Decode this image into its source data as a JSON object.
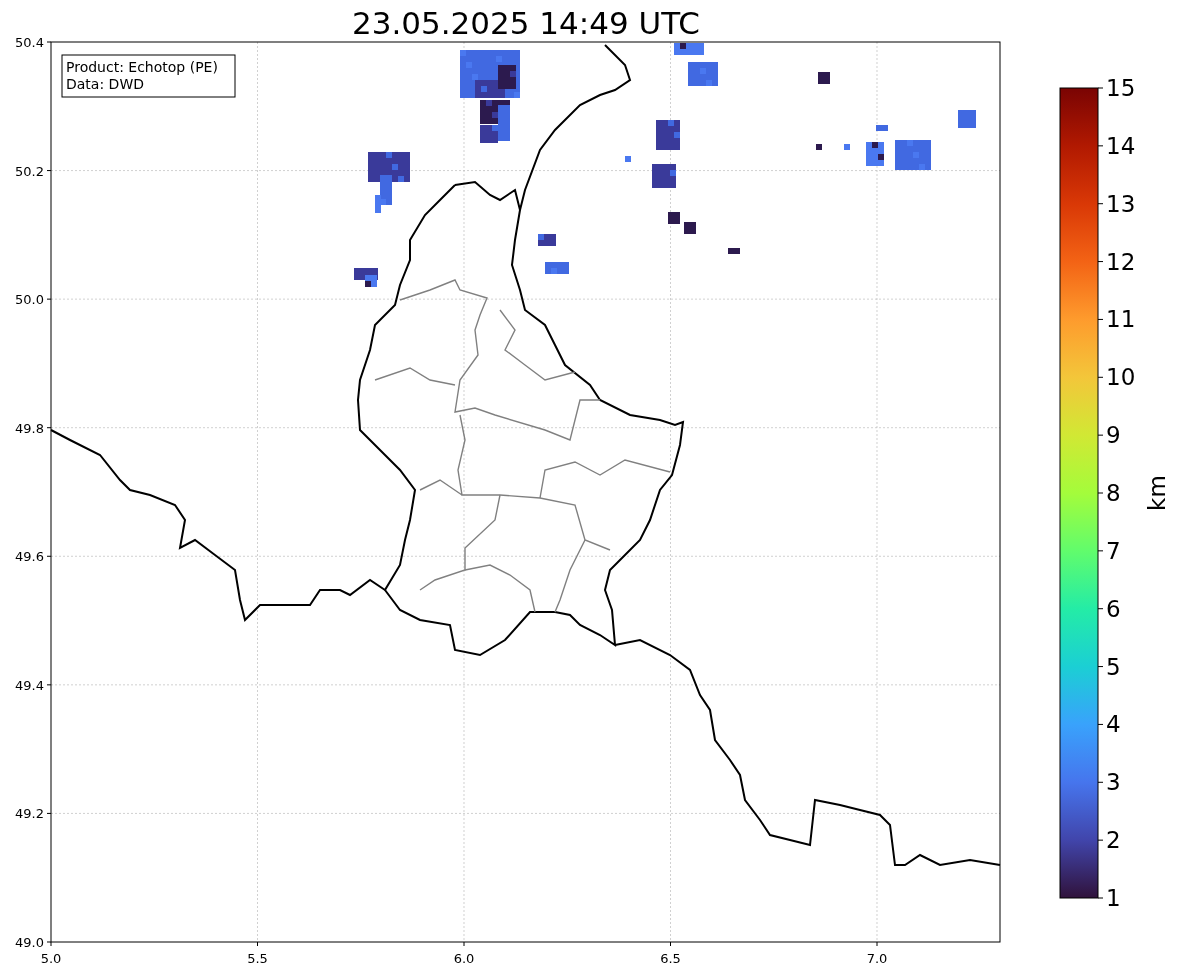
{
  "title": "23.05.2025 14:49 UTC",
  "map": {
    "info_box": [
      "Product: Echotop (PE)",
      "Data: DWD"
    ],
    "xticks": [
      "5.0",
      "5.5",
      "6.0",
      "6.5",
      "7.0"
    ],
    "yticks": [
      "50.4",
      "50.2",
      "50.0",
      "49.8",
      "49.6",
      "49.4",
      "49.2",
      "49.0"
    ]
  },
  "colorbar": {
    "label": "km",
    "ticks": [
      "15",
      "14",
      "13",
      "12",
      "11",
      "10",
      "9",
      "8",
      "7",
      "6",
      "5",
      "4",
      "3",
      "2",
      "1"
    ]
  }
}
